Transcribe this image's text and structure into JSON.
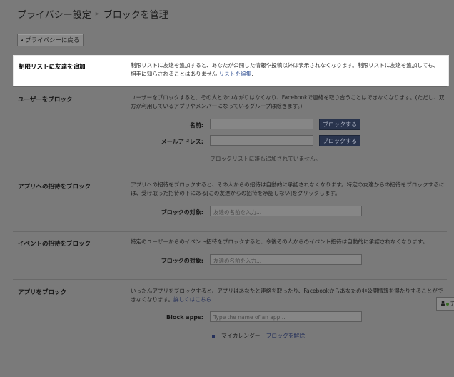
{
  "header": {
    "crumb_parent": "プライバシー設定",
    "crumb_separator": "▸",
    "crumb_current": "ブロックを管理"
  },
  "back_button": {
    "arrow": "◂",
    "label": "プライバシーに戻る"
  },
  "restricted": {
    "title": "制限リストに友達を追加",
    "desc": "制限リストに友達を追加すると、あなたが公開した情報や投稿以外は表示されなくなります。制限リストに友達を追加しても、相手に知らされることはありません",
    "link": "リストを編集",
    "period": "."
  },
  "block_users": {
    "title": "ユーザーをブロック",
    "desc": "ユーザーをブロックすると、その人とのつながりはなくなり、Facebookで連絡を取り合うことはできなくなります。(ただし、双方が利用しているアプリやメンバーになっているグループは除きます。)",
    "name_label": "名前:",
    "email_label": "メールアドレス:",
    "button_label": "ブロックする",
    "empty_note": "ブロックリストに誰も追加されていません。"
  },
  "app_invites": {
    "title": "アプリへの招待をブロック",
    "desc": "アプリへの招待をブロックすると、その人からの招待は自動的に承認されなくなります。特定の友達からの招待をブロックするには、受け取った招待の下にある[この友達からの招待を承認しない]をクリックします。",
    "field_label": "ブロックの対象:",
    "placeholder": "友達の名前を入力..."
  },
  "event_invites": {
    "title": "イベントの招待をブロック",
    "desc": "特定のユーザーからのイベント招待をブロックすると、今後その人からのイベント招待は自動的に承認されなくなります。",
    "field_label": "ブロックの対象:",
    "placeholder": "友達の名前を入力..."
  },
  "block_apps": {
    "title": "アプリをブロック",
    "desc": "いったんアプリをブロックすると、アプリはあなたと連絡を取ったり、Facebookからあなたの非公開情報を得たりすることができなくなります。",
    "link": "詳しくはこちら",
    "field_label": "Block apps:",
    "placeholder": "Type the name of an app...",
    "blocked_items": [
      {
        "name": "マイカレンダー",
        "unblock_label": "ブロックを解除"
      }
    ]
  },
  "chat": {
    "label": "チ",
    "icon": "person-icon",
    "status_color": "#3a6e24"
  },
  "colors": {
    "overlay_bg": "#7a7a7a",
    "button_bg": "#29344d",
    "link": "#3b5998"
  }
}
